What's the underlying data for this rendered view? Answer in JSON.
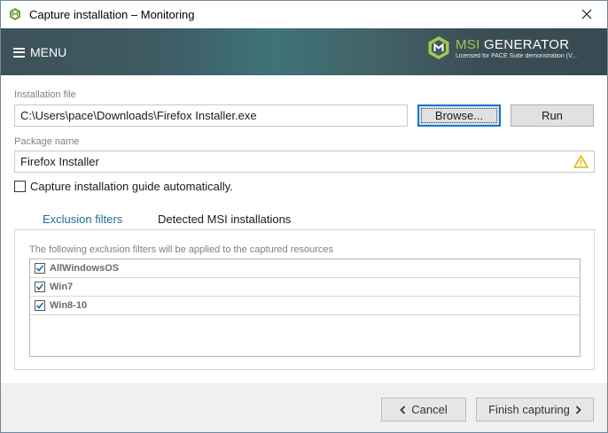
{
  "window": {
    "title": "Capture installation – Monitoring",
    "close_glyph": "✕"
  },
  "header": {
    "menu_label": "MENU",
    "brand_prefix": "MSI",
    "brand_name": "GENERATOR",
    "license_text": "Licensed for PACE Suite demonstration (V...",
    "logo_icon": "msi-generator-logo-icon",
    "colors": {
      "accent": "#a6c84c",
      "band": "#3f6a70"
    }
  },
  "installation_file": {
    "label": "Installation file",
    "value": "C:\\Users\\pace\\Downloads\\Firefox Installer.exe",
    "browse_label": "Browse...",
    "run_label": "Run"
  },
  "package_name": {
    "label": "Package name",
    "value": "Firefox Installer",
    "warning_icon": "warning-icon",
    "warning_color": "#e5b400"
  },
  "capture_guide": {
    "label": "Capture installation guide automatically.",
    "checked": false
  },
  "tabs": [
    {
      "label": "Exclusion filters",
      "active": true
    },
    {
      "label": "Detected MSI installations",
      "active": false
    }
  ],
  "exclusion": {
    "description": "The following exclusion filters will be applied to the captured resources",
    "filters": [
      {
        "label": "AllWindowsOS",
        "checked": true
      },
      {
        "label": "Win7",
        "checked": true
      },
      {
        "label": "Win8-10",
        "checked": true
      }
    ]
  },
  "footer": {
    "cancel_label": "Cancel",
    "finish_label": "Finish capturing",
    "prev_icon": "chevron-left-icon",
    "next_icon": "chevron-right-icon"
  }
}
